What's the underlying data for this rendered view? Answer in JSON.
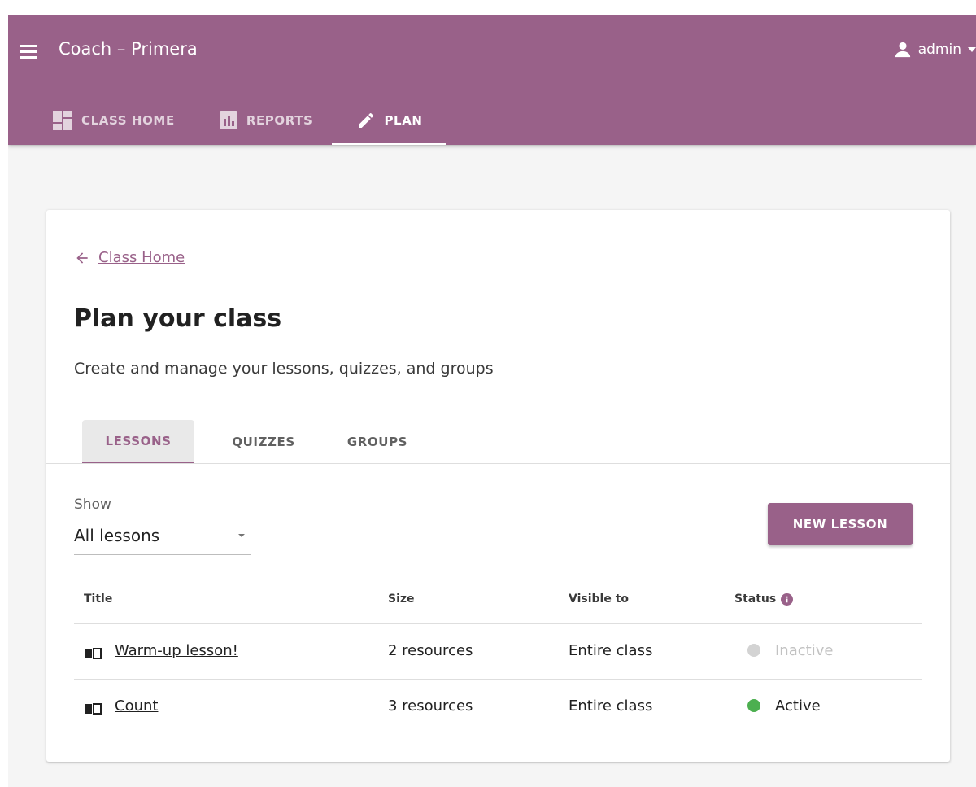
{
  "header": {
    "title": "Coach – Primera",
    "user": "admin",
    "tabs": [
      {
        "label": "CLASS HOME",
        "icon": "dashboard-icon"
      },
      {
        "label": "REPORTS",
        "icon": "bar-chart-icon"
      },
      {
        "label": "PLAN",
        "icon": "pencil-icon"
      }
    ],
    "active_tab": "PLAN"
  },
  "page": {
    "back_link": "Class Home",
    "title": "Plan your class",
    "description": "Create and manage your lessons, quizzes, and groups",
    "tabs": [
      "LESSONS",
      "QUIZZES",
      "GROUPS"
    ],
    "active_tab": "LESSONS"
  },
  "filter": {
    "label": "Show",
    "value": "All lessons"
  },
  "new_button": "NEW LESSON",
  "table": {
    "headers": {
      "title": "Title",
      "size": "Size",
      "visible": "Visible to",
      "status": "Status"
    },
    "rows": [
      {
        "title": "Warm-up lesson!",
        "size": "2 resources",
        "visible": "Entire class",
        "status": "Inactive",
        "status_color": "#d3d3d3"
      },
      {
        "title": "Count",
        "size": "3 resources",
        "visible": "Entire class",
        "status": "Active",
        "status_color": "#4caf50"
      }
    ]
  },
  "colors": {
    "brand": "#996189",
    "active": "#4caf50",
    "inactive": "#d3d3d3"
  }
}
